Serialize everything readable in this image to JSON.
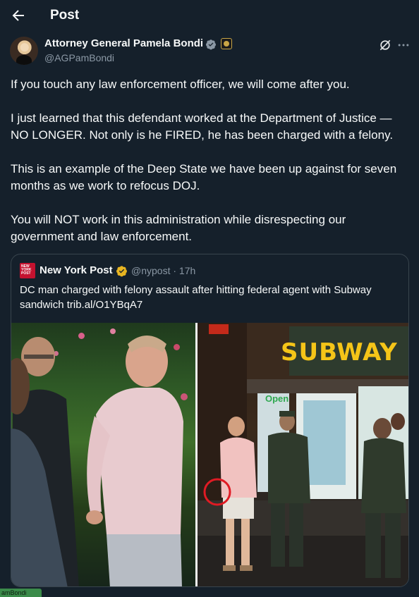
{
  "header": {
    "title": "Post"
  },
  "author": {
    "name": "Attorney General Pamela Bondi",
    "handle": "@AGPamBondi"
  },
  "post": {
    "paragraphs": [
      "If you touch any law enforcement officer, we will come after you.",
      "I just learned that this defendant worked at the Department of Justice — NO LONGER. Not only is he FIRED, he has been charged with a felony.",
      "This is an example of the Deep State we have been up against for seven months as we work to refocus DOJ.",
      "You will NOT work in this administration while disrespecting our government and law enforcement."
    ]
  },
  "quote": {
    "logo_text": "NEW YORK POST",
    "name": "New York Post",
    "handle_time": "@nypost · 17h",
    "text": "DC man charged with felony assault after hitting federal agent with Subway sandwich trib.al/O1YBqA7",
    "sign_text": "SUBWAY",
    "open_sign": "Open"
  },
  "footer": {
    "badge": "amBondi"
  },
  "colors": {
    "background": "#15202b",
    "verified_blue": "#1d9bf0",
    "gold_check": "#e8b521",
    "subway_yellow": "#f5c518",
    "subway_green": "#2ea84f",
    "circle_red": "#e01b24"
  }
}
